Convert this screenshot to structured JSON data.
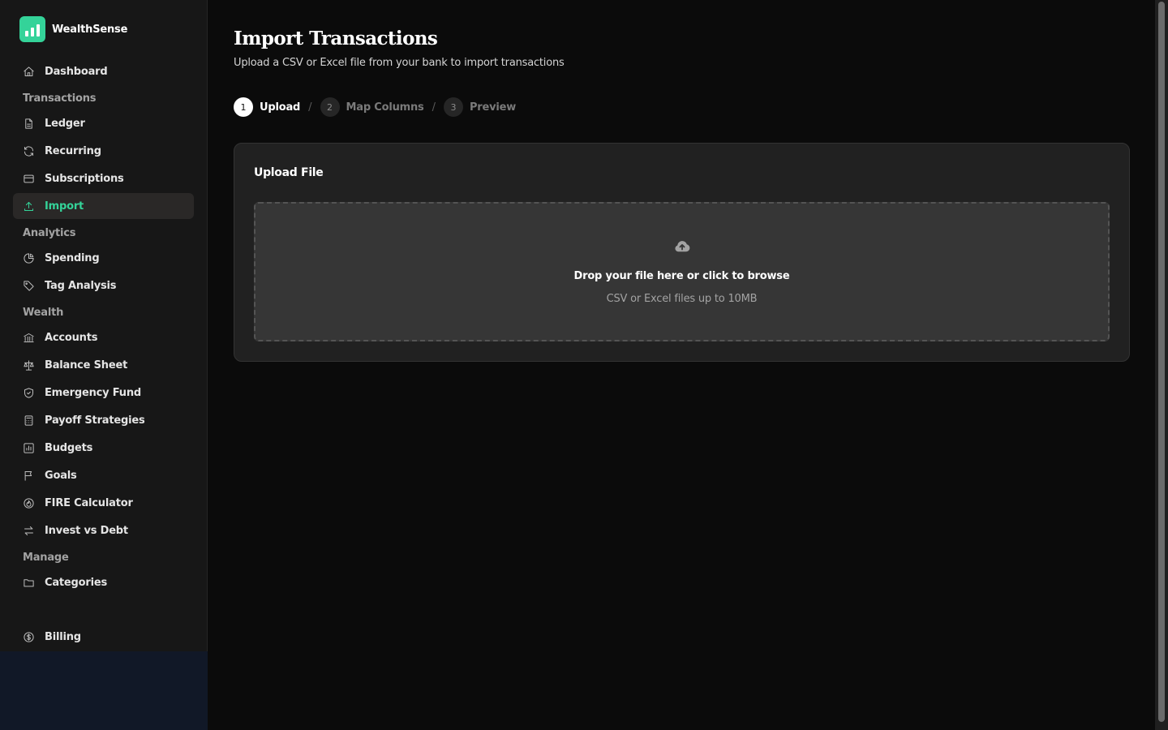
{
  "brand": {
    "name": "WealthSense",
    "accent": "#34d399"
  },
  "sidebar": {
    "items": [
      {
        "label": "Dashboard",
        "icon": "home-icon"
      },
      {
        "label": "Transactions",
        "section": true
      },
      {
        "label": "Ledger",
        "icon": "file-icon"
      },
      {
        "label": "Recurring",
        "icon": "refresh-icon"
      },
      {
        "label": "Subscriptions",
        "icon": "credit-card-icon"
      },
      {
        "label": "Import",
        "icon": "upload-icon",
        "active": true
      },
      {
        "label": "Analytics",
        "section": true
      },
      {
        "label": "Spending",
        "icon": "pie-chart-icon"
      },
      {
        "label": "Tag Analysis",
        "icon": "tag-icon"
      },
      {
        "label": "Wealth",
        "section": true
      },
      {
        "label": "Accounts",
        "icon": "bank-icon"
      },
      {
        "label": "Balance Sheet",
        "icon": "scale-icon"
      },
      {
        "label": "Emergency Fund",
        "icon": "shield-icon"
      },
      {
        "label": "Payoff Strategies",
        "icon": "calculator-icon"
      },
      {
        "label": "Budgets",
        "icon": "bar-chart-icon"
      },
      {
        "label": "Goals",
        "icon": "flag-icon"
      },
      {
        "label": "FIRE Calculator",
        "icon": "flame-icon"
      },
      {
        "label": "Invest vs Debt",
        "icon": "swap-icon"
      },
      {
        "label": "Manage",
        "section": true
      },
      {
        "label": "Categories",
        "icon": "folder-icon"
      }
    ],
    "billing": {
      "label": "Billing",
      "icon": "dollar-circle-icon"
    }
  },
  "page": {
    "title": "Import Transactions",
    "subtitle": "Upload a CSV or Excel file from your bank to import transactions"
  },
  "stepper": {
    "steps": [
      {
        "num": "1",
        "label": "Upload",
        "active": true
      },
      {
        "num": "2",
        "label": "Map Columns",
        "active": false
      },
      {
        "num": "3",
        "label": "Preview",
        "active": false
      }
    ],
    "separator": "/"
  },
  "upload_card": {
    "title": "Upload File",
    "drop_title": "Drop your file here or click to browse",
    "drop_hint": "CSV or Excel files up to 10MB",
    "icon": "cloud-upload-icon"
  }
}
